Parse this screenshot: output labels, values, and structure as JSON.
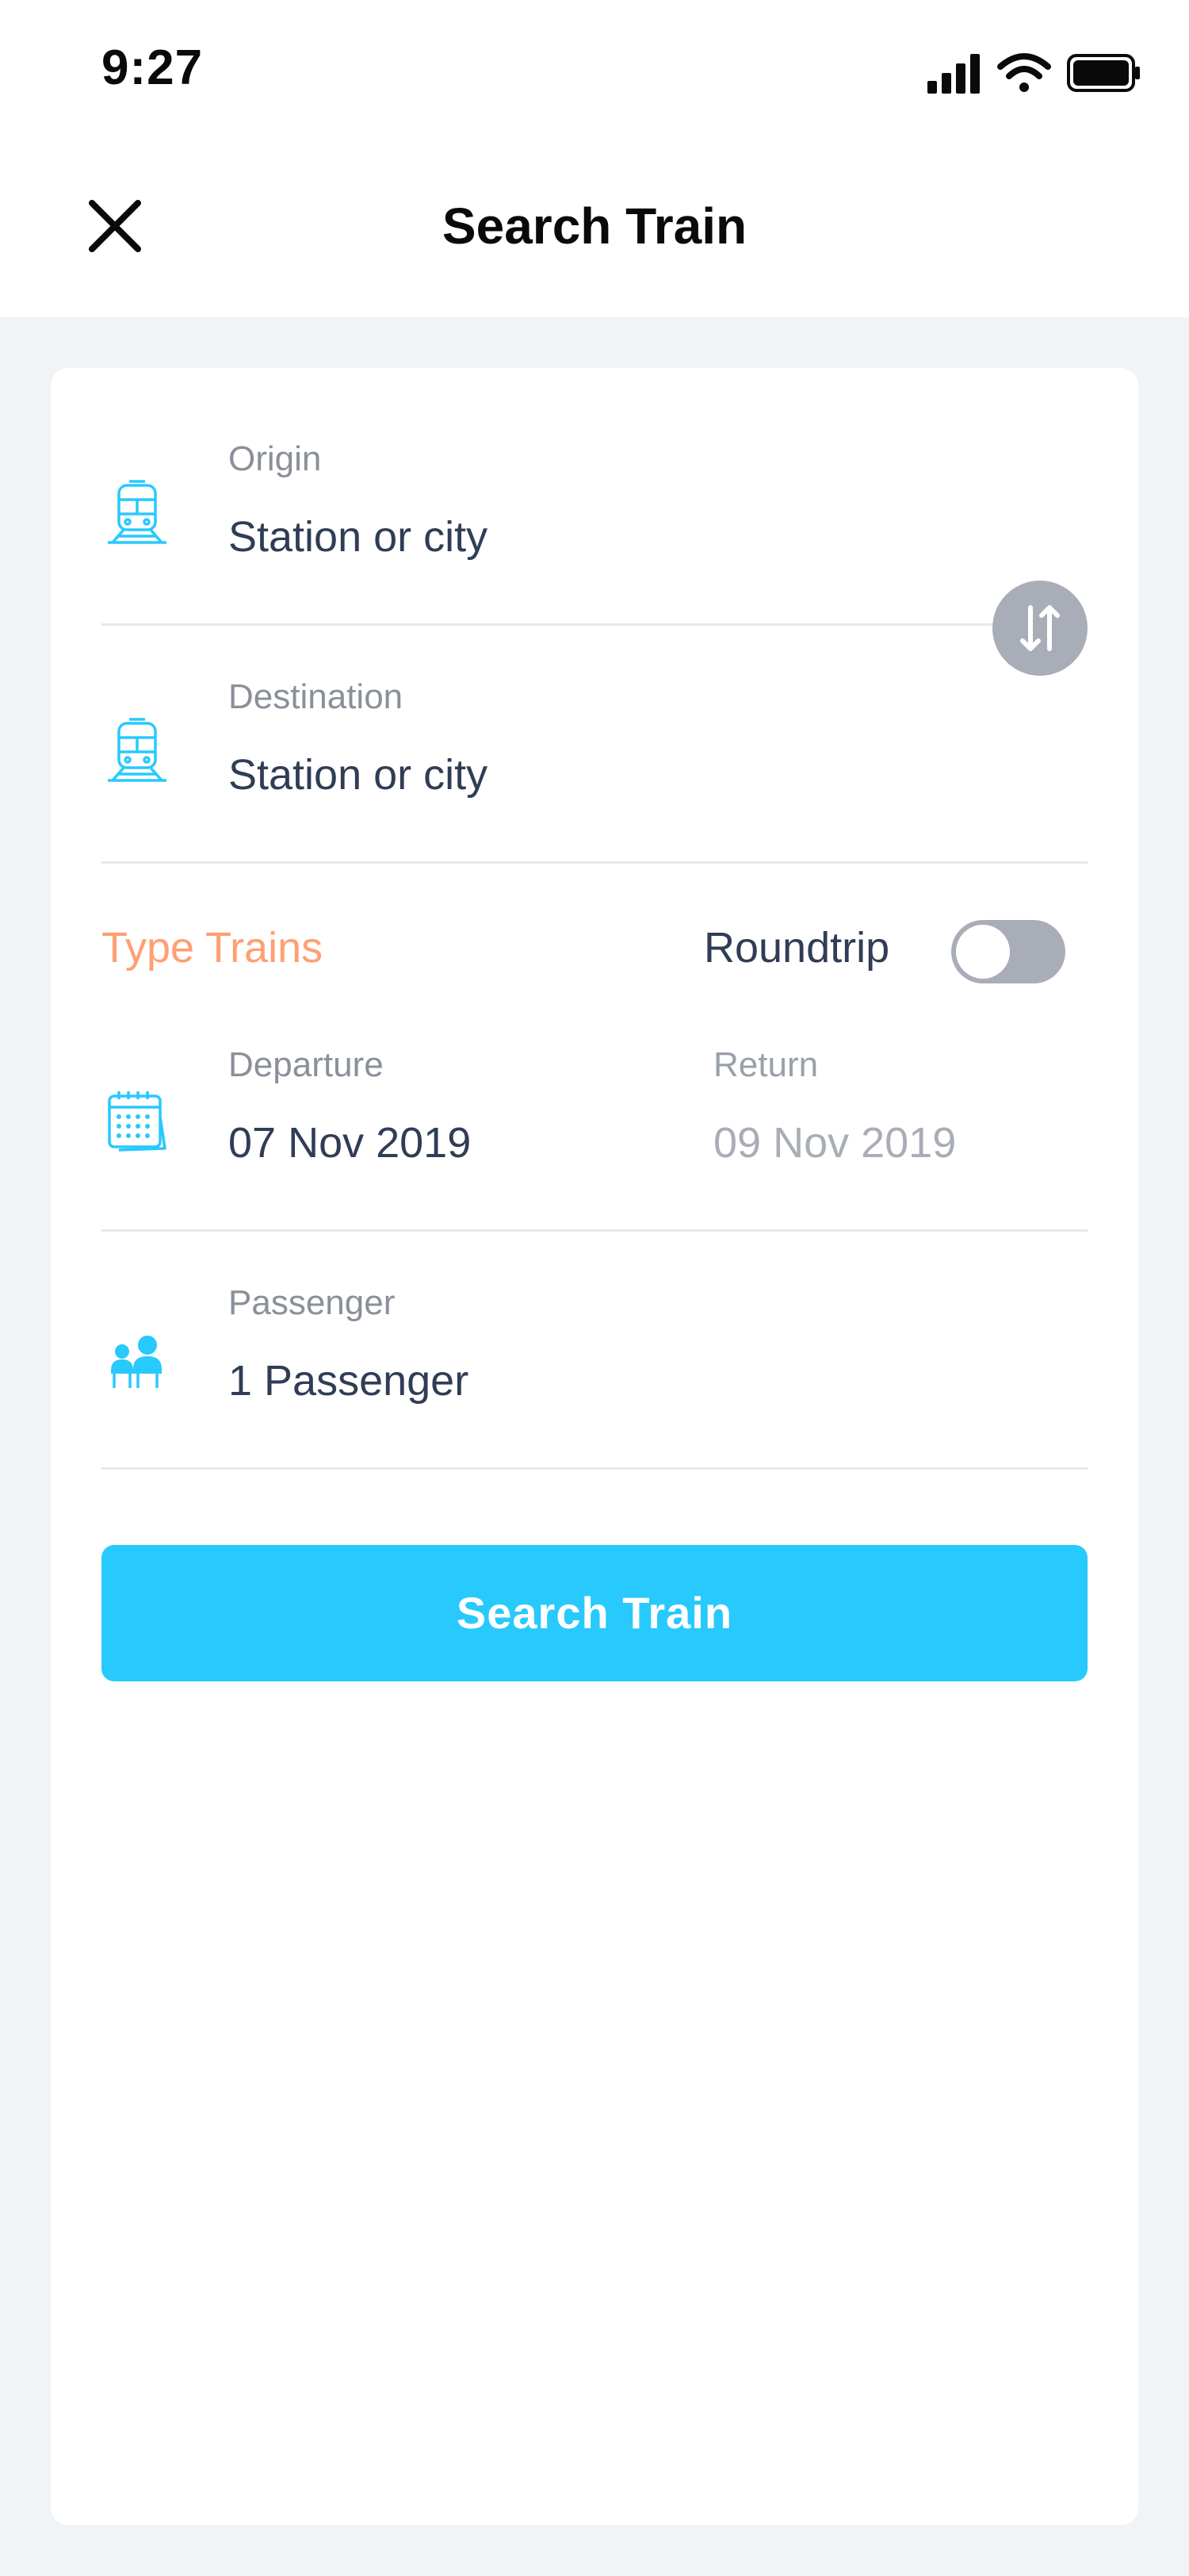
{
  "status_bar": {
    "time": "9:27",
    "icons": [
      "cellular-signal-icon",
      "wifi-icon",
      "battery-icon"
    ]
  },
  "header": {
    "title": "Search Train",
    "close_icon": "close-icon"
  },
  "form": {
    "origin": {
      "label": "Origin",
      "placeholder": "Station or city",
      "icon": "train-icon"
    },
    "destination": {
      "label": "Destination",
      "placeholder": "Station or city",
      "icon": "train-icon"
    },
    "swap_icon": "swap-vertical-icon",
    "type_trains": "Type Trains",
    "roundtrip": {
      "label": "Roundtrip",
      "enabled": false
    },
    "departure": {
      "label": "Departure",
      "value": "07 Nov 2019",
      "icon": "calendar-icon"
    },
    "return": {
      "label": "Return",
      "value": "09 Nov 2019"
    },
    "passenger": {
      "label": "Passenger",
      "value": "1 Passenger",
      "icon": "passengers-icon"
    },
    "search_button": "Search Train"
  },
  "colors": {
    "accent": "#28c9fd",
    "orange": "#ff9f72",
    "muted": "#a9adb8",
    "background": "#f0f4f7"
  }
}
